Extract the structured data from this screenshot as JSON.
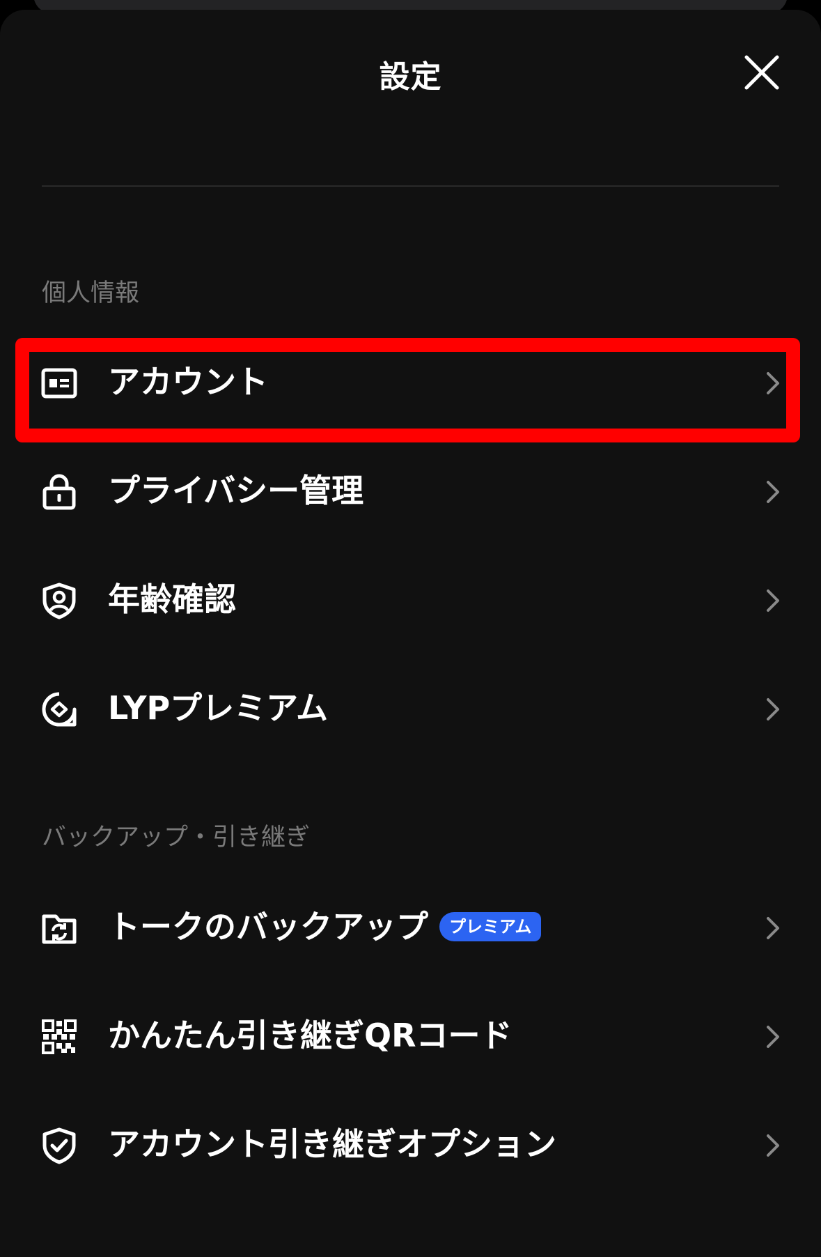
{
  "header": {
    "title": "設定"
  },
  "sections": [
    {
      "label": "個人情報",
      "items": [
        {
          "label": "アカウント",
          "icon": "id-card-icon"
        },
        {
          "label": "プライバシー管理",
          "icon": "lock-icon"
        },
        {
          "label": "年齢確認",
          "icon": "age-verification-shield-icon"
        },
        {
          "label": "LYPプレミアム",
          "icon": "lyp-premium-icon"
        }
      ]
    },
    {
      "label": "バックアップ・引き継ぎ",
      "items": [
        {
          "label": "トークのバックアップ",
          "icon": "folder-sync-icon",
          "badge": "プレミアム"
        },
        {
          "label": "かんたん引き継ぎQRコード",
          "icon": "qr-code-icon"
        },
        {
          "label": "アカウント引き継ぎオプション",
          "icon": "shield-check-icon"
        }
      ]
    }
  ],
  "colors": {
    "background": "#111111",
    "text": "#ffffff",
    "section_label": "#7a7a7a",
    "badge": "#2c64f2",
    "highlight": "#ff0000"
  }
}
